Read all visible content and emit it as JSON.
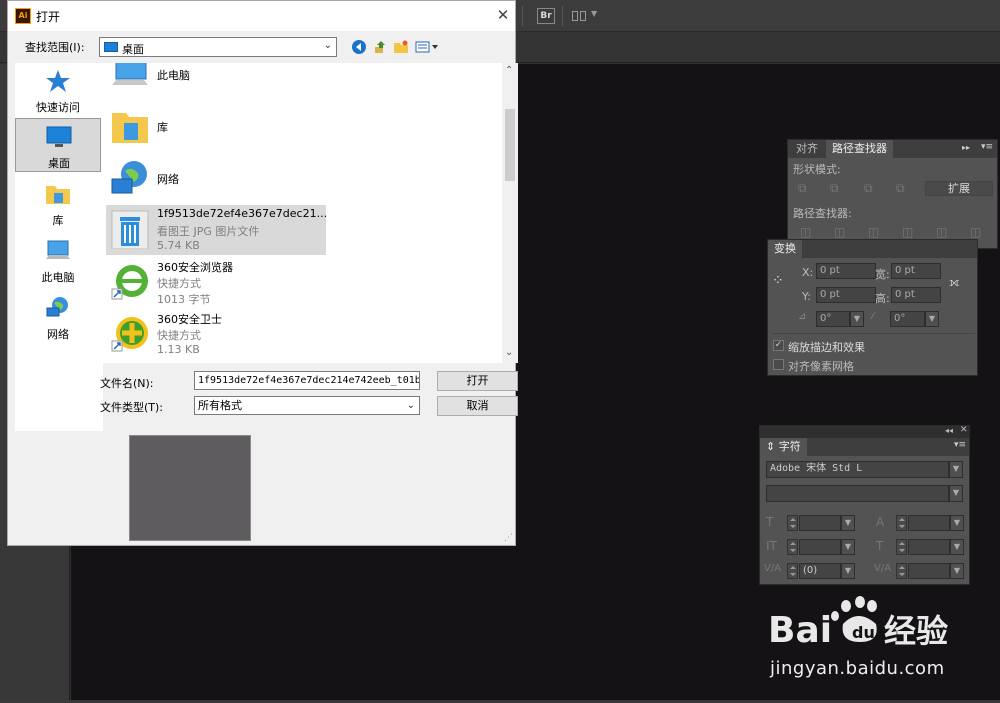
{
  "ai_toolbar": {
    "bridge_label": "Br"
  },
  "pathfinder_panel": {
    "tabs": [
      "对齐",
      "路径查找器"
    ],
    "shape_modes_label": "形状模式:",
    "expand_label": "扩展",
    "pathfinders_label": "路径查找器:"
  },
  "transform_panel": {
    "tab_label": "变换",
    "x_label": "X:",
    "x_value": "0 pt",
    "w_label": "宽:",
    "w_value": "0 pt",
    "y_label": "Y:",
    "y_value": "0 pt",
    "h_label": "高:",
    "h_value": "0 pt",
    "rotate_value": "0°",
    "shear_value": "0°",
    "scale_strokes_label": "缩放描边和效果",
    "scale_strokes_checked": true,
    "align_pixel_label": "对齐像素网格",
    "align_pixel_checked": false
  },
  "character_panel": {
    "tab_label": "字符",
    "font_family": "Adobe 宋体 Std L",
    "font_style": "",
    "tracking_value": "(0)"
  },
  "dialog": {
    "title": "打开",
    "look_in_label": "查找范围(I):",
    "look_in_value": "桌面",
    "places": [
      {
        "label": "快速访问"
      },
      {
        "label": "桌面"
      },
      {
        "label": "库"
      },
      {
        "label": "此电脑"
      },
      {
        "label": "网络"
      }
    ],
    "files": [
      {
        "name": "此电脑",
        "type": "",
        "size": ""
      },
      {
        "name": "库",
        "type": "",
        "size": ""
      },
      {
        "name": "网络",
        "type": "",
        "size": ""
      },
      {
        "name": "1f9513de72ef4e367e7dec21...",
        "type": "看图王 JPG 图片文件",
        "size": "5.74 KB"
      },
      {
        "name": "360安全浏览器",
        "type": "快捷方式",
        "size": "1013 字节"
      },
      {
        "name": "360安全卫士",
        "type": "快捷方式",
        "size": "1.13 KB"
      }
    ],
    "filename_label": "文件名(N):",
    "filename_value": "1f9513de72ef4e367e7dec214e742eeb_t01b",
    "filetype_label": "文件类型(T):",
    "filetype_value": "所有格式",
    "open_label": "打开",
    "cancel_label": "取消"
  },
  "watermark": {
    "logo_text": "Bai",
    "logo_text2": "经验",
    "url": "jingyan.baidu.com"
  }
}
